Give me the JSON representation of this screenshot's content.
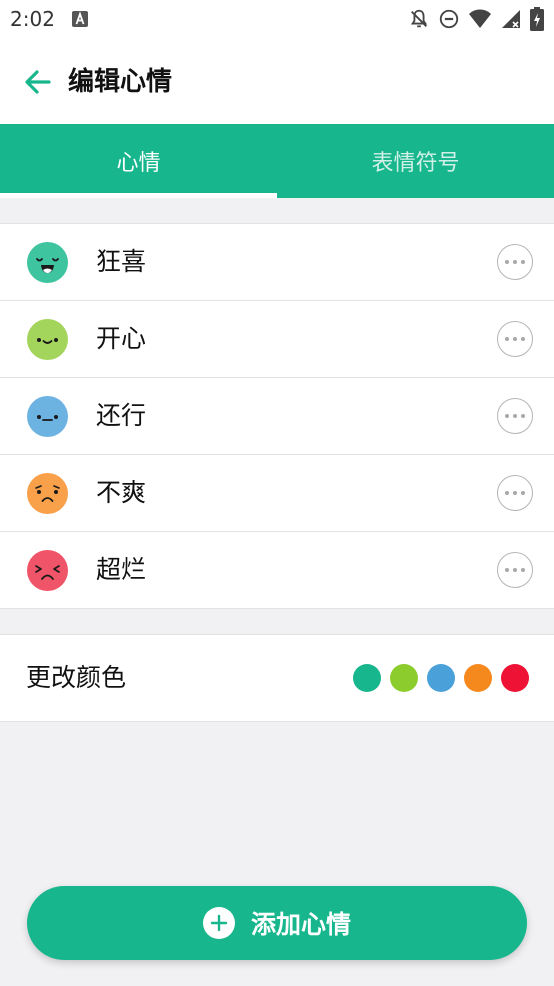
{
  "status_bar": {
    "time": "2:02",
    "icons": [
      "notification-a-icon",
      "bell-off-icon",
      "do-not-disturb-icon",
      "wifi-icon",
      "signal-icon",
      "battery-charging-icon"
    ]
  },
  "header": {
    "title": "编辑心情",
    "back_icon": "arrow-left-icon"
  },
  "tabs": [
    {
      "label": "心情",
      "active": true
    },
    {
      "label": "表情符号",
      "active": false
    }
  ],
  "moods": [
    {
      "label": "狂喜",
      "color": "#3fc4a0",
      "face": "ecstatic"
    },
    {
      "label": "开心",
      "color": "#a3d45b",
      "face": "happy"
    },
    {
      "label": "还行",
      "color": "#6db3e2",
      "face": "okay"
    },
    {
      "label": "不爽",
      "color": "#f9a04a",
      "face": "unhappy"
    },
    {
      "label": "超烂",
      "color": "#f05468",
      "face": "awful"
    }
  ],
  "color_section": {
    "label": "更改颜色",
    "swatches": [
      "#17b68c",
      "#8ccc2c",
      "#4aa0d8",
      "#f5891e",
      "#ee1234"
    ]
  },
  "add_button": {
    "label": "添加心情"
  },
  "theme": {
    "primary": "#17b68c",
    "background": "#f1f1f3"
  }
}
